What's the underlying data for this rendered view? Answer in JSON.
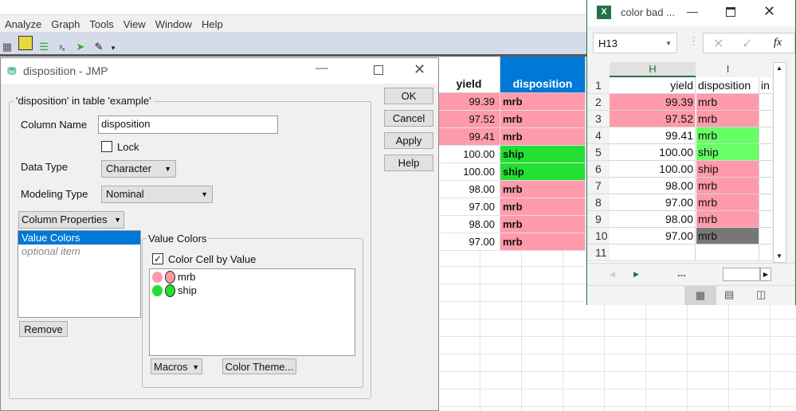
{
  "menu": [
    "Analyze",
    "Graph",
    "Tools",
    "View",
    "Window",
    "Help"
  ],
  "colors": {
    "pink": "#ff9aab",
    "green": "#22e033",
    "header_blue": "#0078d7",
    "excel_green": "#66ff66",
    "excel_gray": "#777777"
  },
  "jmp_grid": {
    "headers": [
      "yield",
      "disposition"
    ],
    "rows": [
      [
        "99.39",
        "mrb"
      ],
      [
        "97.52",
        "mrb"
      ],
      [
        "99.41",
        "mrb"
      ],
      [
        "100.00",
        "ship"
      ],
      [
        "100.00",
        "ship"
      ],
      [
        "98.00",
        "mrb"
      ],
      [
        "97.00",
        "mrb"
      ],
      [
        "98.00",
        "mrb"
      ],
      [
        "97.00",
        "mrb"
      ]
    ]
  },
  "dialog": {
    "title": "disposition - JMP",
    "group": "'disposition' in table 'example'",
    "column_name_label": "Column Name",
    "column_name_value": "disposition",
    "lock_label": "Lock",
    "data_type_label": "Data Type",
    "data_type_value": "Character",
    "modeling_type_label": "Modeling Type",
    "modeling_type_value": "Nominal",
    "column_properties": "Column Properties",
    "props": [
      "Value Colors",
      "optional item"
    ],
    "remove": "Remove",
    "value_colors_group": "Value Colors",
    "color_cell_label": "Color Cell by Value",
    "values": [
      "mrb",
      "ship"
    ],
    "macros": "Macros",
    "color_theme": "Color Theme...",
    "buttons": [
      "OK",
      "Cancel",
      "Apply",
      "Help"
    ]
  },
  "excel": {
    "title": "color bad ...",
    "name_box": "H13",
    "fx": "fx",
    "cols": [
      "H",
      "I"
    ],
    "rows": [
      [
        "1",
        "yield",
        "disposition",
        "in"
      ],
      [
        "2",
        "99.39",
        "mrb",
        ""
      ],
      [
        "3",
        "97.52",
        "mrb",
        ""
      ],
      [
        "4",
        "99.41",
        "mrb",
        ""
      ],
      [
        "5",
        "100.00",
        "ship",
        ""
      ],
      [
        "6",
        "100.00",
        "ship",
        ""
      ],
      [
        "7",
        "98.00",
        "mrb",
        ""
      ],
      [
        "8",
        "97.00",
        "mrb",
        ""
      ],
      [
        "9",
        "98.00",
        "mrb",
        ""
      ],
      [
        "10",
        "97.00",
        "mrb",
        ""
      ],
      [
        "11",
        "",
        "",
        ""
      ]
    ],
    "ellipsis": "..."
  }
}
